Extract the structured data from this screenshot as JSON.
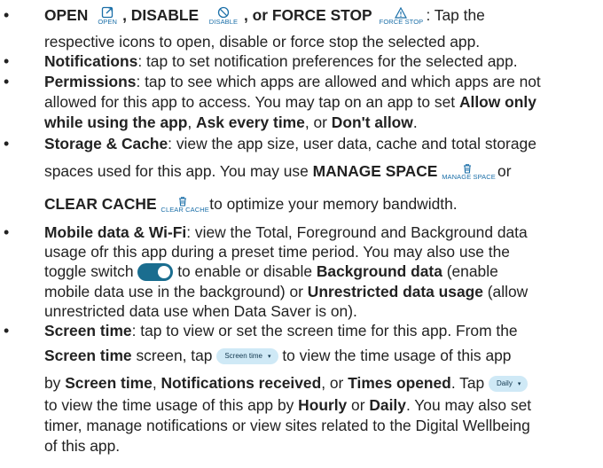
{
  "colors": {
    "text": "#222222",
    "icon_accent": "#1b6fa8",
    "chip_bg": "#cfe9f6",
    "toggle_bg": "#1a6d8f"
  },
  "icons": {
    "open": {
      "name": "open-external-icon",
      "caption": "OPEN"
    },
    "disable": {
      "name": "disable-icon",
      "caption": "DISABLE"
    },
    "force_stop": {
      "name": "warning-icon",
      "caption": "FORCE STOP"
    },
    "manage_space": {
      "name": "trash-icon",
      "caption": "MANAGE SPACE"
    },
    "clear_cache": {
      "name": "trash-icon",
      "caption": "CLEAR CACHE"
    }
  },
  "chips": {
    "screen_time": "Screen time",
    "daily": "Daily"
  },
  "items": {
    "open": {
      "t1": "OPEN",
      "t2": ", DISABLE",
      "t3": ", or FORCE STOP",
      "t4": ": Tap the",
      "t5": "respective icons to open, disable or force stop the selected app."
    },
    "notifications": {
      "t1": "Notifications",
      "t2": ": tap to set notification preferences for the selected app."
    },
    "permissions": {
      "t1": "Permissions",
      "t2": ": tap to see which apps are allowed and which apps are not",
      "t3": "allowed for this app to access. You may tap on an app to set",
      "t4": "Allow only",
      "t5": "while using the app",
      "t6": ", ",
      "t7": "Ask every time",
      "t8": ", or ",
      "t9": "Don't allow",
      "t10": "."
    },
    "storage": {
      "t1": "Storage & Cache",
      "t2": ": view the app size, user data, cache and total storage",
      "t3": "spaces used for this app. You may use ",
      "t4": "MANAGE SPACE",
      "t5": " or",
      "t6": "CLEAR CACHE",
      "t7": " to optimize your memory bandwidth."
    },
    "mobile": {
      "t1": "Mobile data & Wi-Fi",
      "t2": ": view the Total, Foreground and Background data",
      "t3": "usage ofr this app during a preset time period. You may also use the",
      "t4": "toggle switch ",
      "t5": " to enable or disable ",
      "t6": "Background data",
      "t7": " (enable",
      "t8": "mobile data use in the background) or ",
      "t9": "Unrestricted data usage",
      "t10": " (allow",
      "t11": "unrestricted data use when Data Saver is on)."
    },
    "screen": {
      "t1": "Screen time",
      "t2": ": tap to view or set the screen time for this app. From the",
      "t3": "Screen time",
      "t4": " screen, tap ",
      "t5": " to view the time usage of this app",
      "t6": "by ",
      "t7": "Screen time",
      "t8": ", ",
      "t9": "Notifications received",
      "t10": ", or ",
      "t11": "Times opened",
      "t12": ". Tap ",
      "t13": "to view the time usage of this app by ",
      "t14": "Hourly",
      "t15": " or ",
      "t16": "Daily",
      "t17": ". You may also set",
      "t18": "timer, manage notifications or view sites related to the Digital Wellbeing",
      "t19": "of this app."
    }
  }
}
